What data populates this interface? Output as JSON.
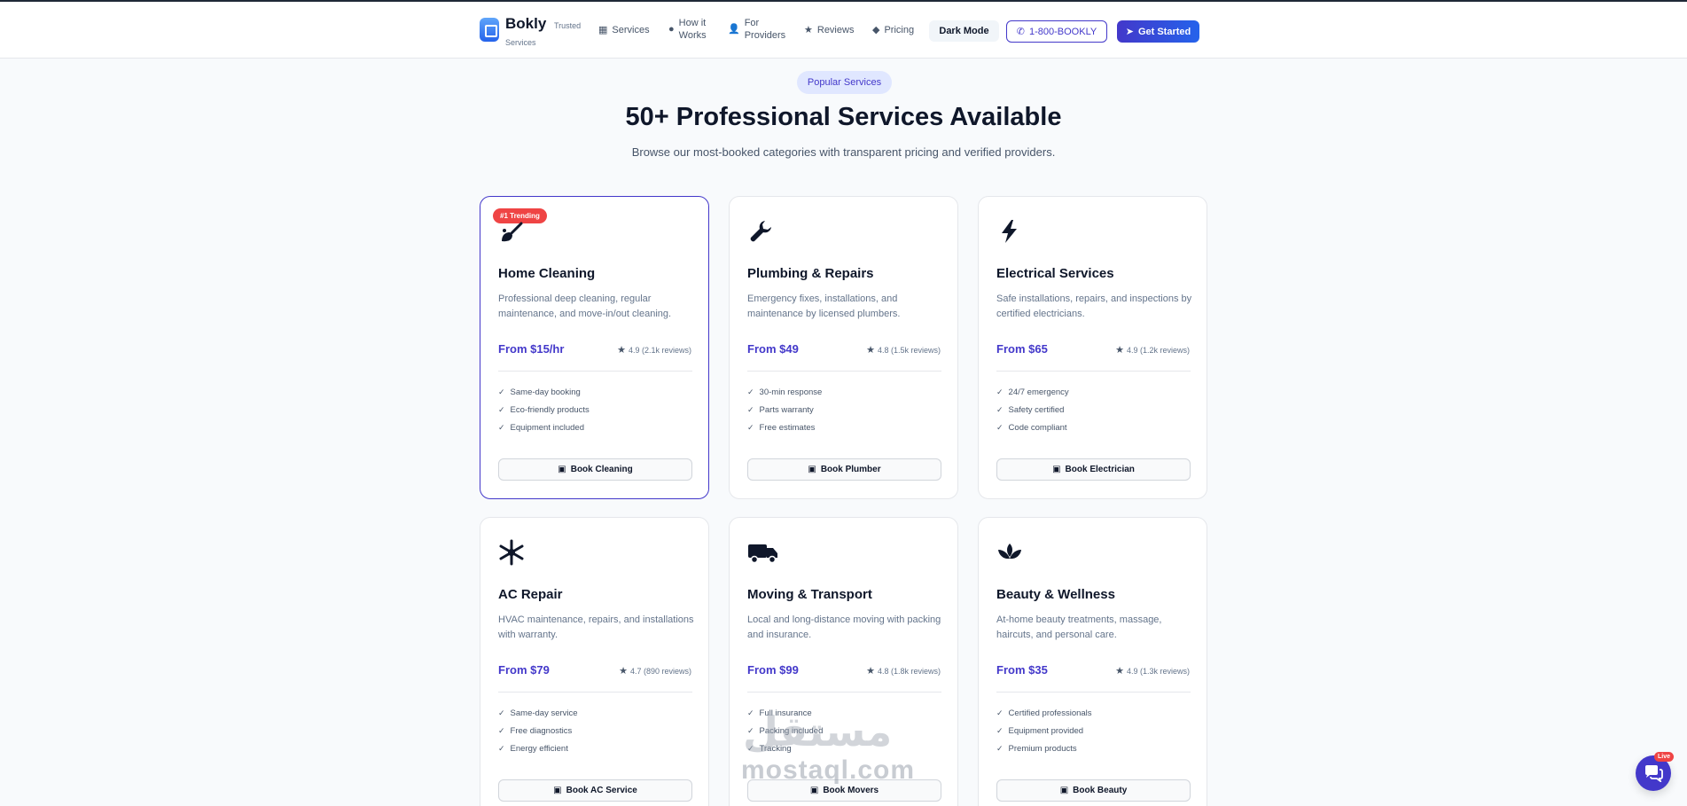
{
  "header": {
    "brand": "Bokly",
    "brand_tag_1": "Trusted",
    "brand_tag_2": "Services",
    "nav": [
      {
        "label": "Services",
        "icon": "grid-icon"
      },
      {
        "label_1": "How it",
        "label_2": "Works",
        "icon": "play-circle-icon"
      },
      {
        "label_1": "For",
        "label_2": "Providers",
        "icon": "user-plus-icon"
      },
      {
        "label": "Reviews",
        "icon": "star-icon"
      },
      {
        "label": "Pricing",
        "icon": "tag-icon"
      }
    ],
    "dark_mode_label": "Dark Mode",
    "phone_label": "1-800-BOOKLY",
    "get_started_label": "Get Started"
  },
  "section": {
    "pill": "Popular Services",
    "title": "50+ Professional Services Available",
    "subtitle": "Browse our most-booked categories with transparent pricing and verified providers."
  },
  "cards": [
    {
      "badge": "#1 Trending",
      "icon": "broom-icon",
      "title": "Home Cleaning",
      "desc": "Professional deep cleaning, regular maintenance, and move-in/out cleaning.",
      "price": "From $15/hr",
      "rating": "4.9 (2.1k reviews)",
      "features": [
        "Same-day booking",
        "Eco-friendly products",
        "Equipment included"
      ],
      "button": "Book Cleaning"
    },
    {
      "icon": "wrench-icon",
      "title": "Plumbing & Repairs",
      "desc": "Emergency fixes, installations, and maintenance by licensed plumbers.",
      "price": "From $49",
      "rating": "4.8 (1.5k reviews)",
      "features": [
        "30-min response",
        "Parts warranty",
        "Free estimates"
      ],
      "button": "Book Plumber"
    },
    {
      "icon": "bolt-icon",
      "title": "Electrical Services",
      "desc": "Safe installations, repairs, and inspections by certified electricians.",
      "price": "From $65",
      "rating": "4.9 (1.2k reviews)",
      "features": [
        "24/7 emergency",
        "Safety certified",
        "Code compliant"
      ],
      "button": "Book Electrician"
    },
    {
      "icon": "snowflake-icon",
      "title": "AC Repair",
      "desc": "HVAC maintenance, repairs, and installations with warranty.",
      "price": "From $79",
      "rating": "4.7 (890 reviews)",
      "features": [
        "Same-day service",
        "Free diagnostics",
        "Energy efficient"
      ],
      "button": "Book AC Service"
    },
    {
      "icon": "truck-icon",
      "title": "Moving & Transport",
      "desc": "Local and long-distance moving with packing and insurance.",
      "price": "From $99",
      "rating": "4.8 (1.8k reviews)",
      "features": [
        "Full insurance",
        "Packing included",
        "Tracking"
      ],
      "button": "Book Movers"
    },
    {
      "icon": "lotus-icon",
      "title": "Beauty & Wellness",
      "desc": "At-home beauty treatments, massage, haircuts, and personal care.",
      "price": "From $35",
      "rating": "4.9 (1.3k reviews)",
      "features": [
        "Certified professionals",
        "Equipment provided",
        "Premium products"
      ],
      "button": "Book Beauty"
    }
  ],
  "chat": {
    "live_label": "Live",
    "icon": "chat-icon"
  },
  "watermark": {
    "latin": "mostaql.com",
    "arabic": "مستقل"
  },
  "colors": {
    "accent": "#4338ca",
    "badge": "#ef4444",
    "pill_bg": "#e0e7ff"
  }
}
